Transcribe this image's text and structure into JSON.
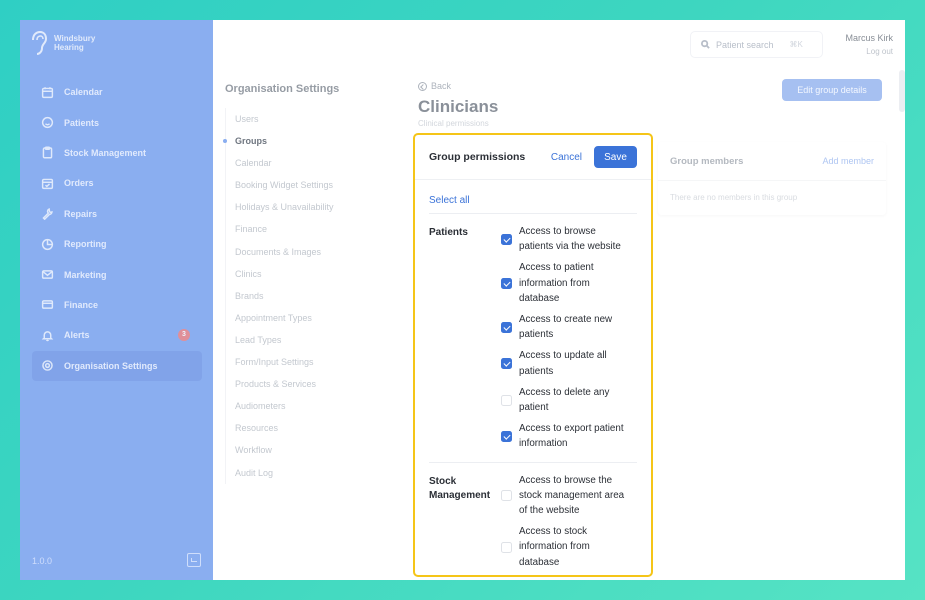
{
  "brand": {
    "line1": "Windsbury",
    "line2": "Hearing"
  },
  "sidebar": {
    "items": [
      {
        "label": "Calendar",
        "icon": "calendar-icon",
        "active": false,
        "badge": ""
      },
      {
        "label": "Patients",
        "icon": "smile-icon",
        "active": false,
        "badge": ""
      },
      {
        "label": "Stock Management",
        "icon": "clipboard-icon",
        "active": false,
        "badge": ""
      },
      {
        "label": "Orders",
        "icon": "calendar-check-icon",
        "active": false,
        "badge": ""
      },
      {
        "label": "Repairs",
        "icon": "wrench-icon",
        "active": false,
        "badge": ""
      },
      {
        "label": "Reporting",
        "icon": "pie-chart-icon",
        "active": false,
        "badge": ""
      },
      {
        "label": "Marketing",
        "icon": "mail-icon",
        "active": false,
        "badge": ""
      },
      {
        "label": "Finance",
        "icon": "credit-card-icon",
        "active": false,
        "badge": ""
      },
      {
        "label": "Alerts",
        "icon": "bell-icon",
        "active": false,
        "badge": "3"
      },
      {
        "label": "Organisation Settings",
        "icon": "gear-icon",
        "active": true,
        "badge": ""
      }
    ],
    "version": "1.0.0"
  },
  "topbar": {
    "search_placeholder": "Patient search",
    "shortcut": "⌘K",
    "user_name": "Marcus Kirk",
    "logout": "Log out"
  },
  "settings_nav": {
    "title": "Organisation Settings",
    "items": [
      {
        "label": "Users",
        "active": false
      },
      {
        "label": "Groups",
        "active": true
      },
      {
        "label": "Calendar",
        "active": false
      },
      {
        "label": "Booking Widget Settings",
        "active": false
      },
      {
        "label": "Holidays & Unavailability",
        "active": false
      },
      {
        "label": "Finance",
        "active": false
      },
      {
        "label": "Documents & Images",
        "active": false
      },
      {
        "label": "Clinics",
        "active": false
      },
      {
        "label": "Brands",
        "active": false
      },
      {
        "label": "Appointment Types",
        "active": false
      },
      {
        "label": "Lead Types",
        "active": false
      },
      {
        "label": "Form/Input Settings",
        "active": false
      },
      {
        "label": "Products & Services",
        "active": false
      },
      {
        "label": "Audiometers",
        "active": false
      },
      {
        "label": "Resources",
        "active": false
      },
      {
        "label": "Workflow",
        "active": false
      },
      {
        "label": "Audit Log",
        "active": false
      }
    ]
  },
  "page": {
    "back": "Back",
    "title": "Clinicians",
    "subtitle": "Clinical permissions",
    "edit_button": "Edit group details"
  },
  "members": {
    "title": "Group members",
    "add": "Add member",
    "empty": "There are no members in this group"
  },
  "permissions": {
    "title": "Group permissions",
    "cancel": "Cancel",
    "save": "Save",
    "select_all": "Select all",
    "sections": [
      {
        "label": "Patients",
        "items": [
          {
            "text": "Access to browse patients via the website",
            "checked": true
          },
          {
            "text": "Access to patient information from database",
            "checked": true
          },
          {
            "text": "Access to create new patients",
            "checked": true
          },
          {
            "text": "Access to update all patients",
            "checked": true
          },
          {
            "text": "Access to delete any patient",
            "checked": false
          },
          {
            "text": "Access to export patient information",
            "checked": true
          }
        ]
      },
      {
        "label": "Stock Management",
        "items": [
          {
            "text": "Access to browse the stock management area of the website",
            "checked": false
          },
          {
            "text": "Access to stock information from database",
            "checked": false
          }
        ]
      }
    ]
  },
  "colors": {
    "accent": "#3b73d8",
    "sidebar": "#8aaef0",
    "focus": "#f5c518",
    "background": "#3dd6c0"
  }
}
